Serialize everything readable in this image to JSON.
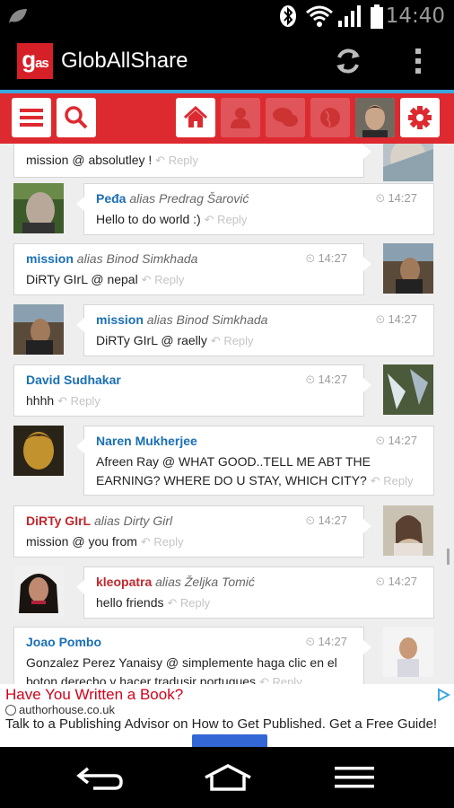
{
  "status_bar": {
    "time": "14:40",
    "icons": [
      "leaf-app-icon",
      "bluetooth-icon",
      "wifi-icon",
      "signal-icon",
      "battery-icon"
    ]
  },
  "app_bar": {
    "logo_main": "g",
    "logo_sub": "as",
    "title": "GlobAllShare",
    "actions": [
      "refresh-icon",
      "overflow-menu-icon"
    ]
  },
  "toolbar": {
    "left": [
      "menu-icon",
      "search-icon"
    ],
    "right": [
      "home-icon",
      "user-icon",
      "chat-icon",
      "globe-icon",
      "profile-avatar",
      "settings-icon"
    ]
  },
  "messages": [
    {
      "side": "left",
      "author": "",
      "alias": "",
      "text": "mission @ absolutley !",
      "time": "",
      "reply": "Reply"
    },
    {
      "side": "right",
      "author": "Peđa",
      "alias": "alias Predrag Šarović",
      "text": "Hello to do world :)",
      "time": "14:27",
      "reply": "Reply"
    },
    {
      "side": "left",
      "author": "mission",
      "alias": "alias Binod Simkhada",
      "text": "DiRTy GIrL @ nepal",
      "time": "14:27",
      "reply": "Reply"
    },
    {
      "side": "right",
      "author": "mission",
      "alias": "alias Binod Simkhada",
      "text": "DiRTy GIrL @ raelly",
      "time": "14:27",
      "reply": "Reply"
    },
    {
      "side": "left",
      "author": "David Sudhakar",
      "alias": "",
      "text": "hhhh",
      "time": "14:27",
      "reply": "Reply"
    },
    {
      "side": "right",
      "author": "Naren Mukherjee",
      "alias": "",
      "text": "Afreen Ray @ WHAT GOOD..TELL ME ABT THE EARNING? WHERE DO U STAY, WHICH CITY?",
      "time": "14:27",
      "reply": "Reply"
    },
    {
      "side": "left",
      "author": "DiRTy GIrL",
      "alias": "alias Dirty Girl",
      "text": "mission @ you from",
      "time": "14:27",
      "reply": "Reply"
    },
    {
      "side": "right",
      "author": "kleopatra",
      "alias": "alias Željka Tomić",
      "text": "hello friends",
      "time": "14:27",
      "reply": "Reply"
    },
    {
      "side": "left",
      "author": "Joao Pombo",
      "alias": "",
      "text": "Gonzalez Perez Yanaisy @ simplemente haga clic en el boton derecho y hacer tradusir portugues",
      "time": "14:27",
      "reply": "Reply"
    }
  ],
  "ad": {
    "title": "Have You Written a Book?",
    "source": "authorhouse.co.uk",
    "text": "Talk to a Publishing Advisor on How to Get Published. Get a Free Guide!"
  },
  "nav_bar": [
    "back-icon",
    "home-icon",
    "recents-icon"
  ]
}
